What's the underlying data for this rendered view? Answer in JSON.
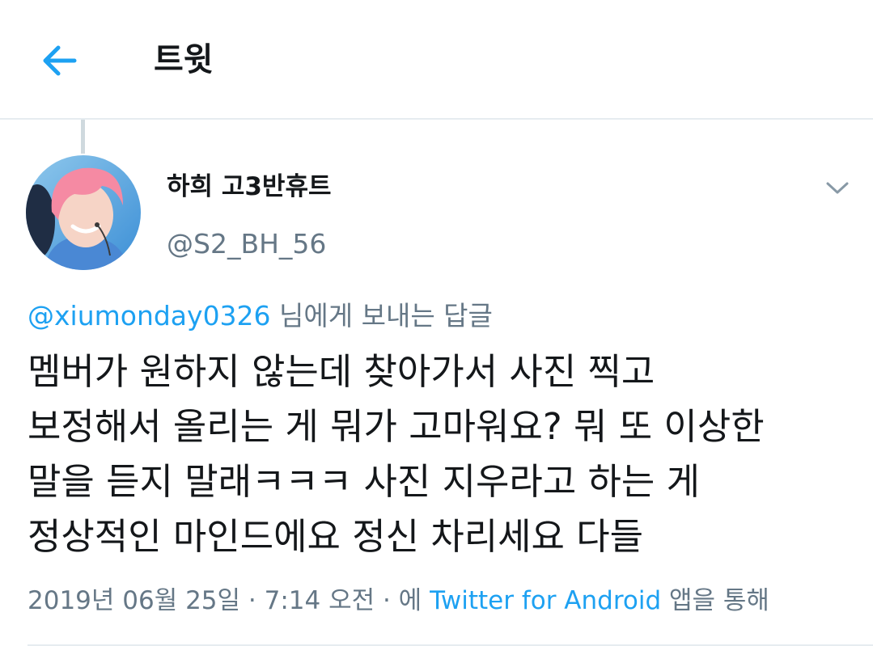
{
  "header": {
    "title": "트윗",
    "back_icon": "arrow-left-icon",
    "accent_color": "#1da1f2"
  },
  "tweet": {
    "author": {
      "display_name": "하희 고3반휴트",
      "handle": "@S2_BH_56"
    },
    "menu_icon": "chevron-down-icon",
    "reply_to": {
      "mention": "@xiumonday0326",
      "suffix": " 님에게 보내는 답글"
    },
    "text_lines": [
      "멤버가 원하지 않는데 찾아가서 사진 찍고",
      "보정해서 올리는 게 뭐가 고마워요? 뭐 또 이상한",
      "말을 듣지 말래ㅋㅋㅋ 사진 지우라고 하는 게",
      "정상적인 마인드에요 정신 차리세요 다들"
    ],
    "meta": {
      "timestamp": "2019년 06월 25일 · 7:14 오전 · 에 ",
      "source": "Twitter for Android",
      "source_suffix": " 앱을 통해"
    }
  }
}
